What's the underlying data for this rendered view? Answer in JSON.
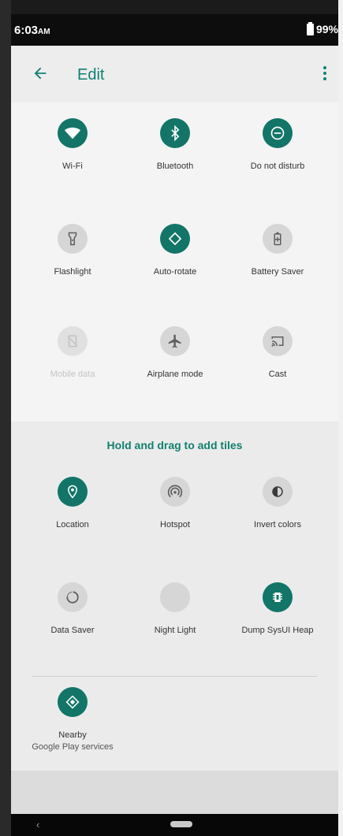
{
  "status_bar": {
    "time": "6:03",
    "ampm": "AM",
    "battery": "99%",
    "battery_icon": "battery-icon"
  },
  "toolbar": {
    "back_icon": "back-arrow-icon",
    "title": "Edit",
    "menu_icon": "more-vert-icon"
  },
  "active_tiles": [
    {
      "label": "Wi-Fi",
      "icon": "wifi-icon",
      "state": "on"
    },
    {
      "label": "Bluetooth",
      "icon": "bluetooth-icon",
      "state": "on"
    },
    {
      "label": "Do not disturb",
      "icon": "do-not-disturb-icon",
      "state": "on"
    },
    {
      "label": "Flashlight",
      "icon": "flashlight-icon",
      "state": "off"
    },
    {
      "label": "Auto-rotate",
      "icon": "auto-rotate-icon",
      "state": "on"
    },
    {
      "label": "Battery Saver",
      "icon": "battery-saver-icon",
      "state": "off"
    },
    {
      "label": "Mobile data",
      "icon": "mobile-data-icon",
      "state": "disabled"
    },
    {
      "label": "Airplane mode",
      "icon": "airplane-icon",
      "state": "off"
    },
    {
      "label": "Cast",
      "icon": "cast-icon",
      "state": "off"
    }
  ],
  "drag_hint": "Hold and drag to add tiles",
  "available_tiles": [
    {
      "label": "Location",
      "icon": "location-icon",
      "state": "on"
    },
    {
      "label": "Hotspot",
      "icon": "hotspot-icon",
      "state": "off"
    },
    {
      "label": "Invert colors",
      "icon": "invert-colors-icon",
      "state": "off"
    },
    {
      "label": "Data Saver",
      "icon": "data-saver-icon",
      "state": "off"
    },
    {
      "label": "Night Light",
      "icon": "night-light-icon",
      "state": "off"
    },
    {
      "label": "Dump SysUI Heap",
      "icon": "memory-chip-icon",
      "state": "on"
    }
  ],
  "third_party_tiles": [
    {
      "label": "Nearby",
      "sublabel": "Google Play services",
      "icon": "nearby-icon",
      "state": "on"
    }
  ],
  "nav_bar": {
    "back_icon": "nav-back-icon",
    "home_icon": "nav-home-pill-icon"
  },
  "colors": {
    "accent": "#127567",
    "hint_text": "#12806f",
    "tile_off": "#d6d6d6"
  }
}
